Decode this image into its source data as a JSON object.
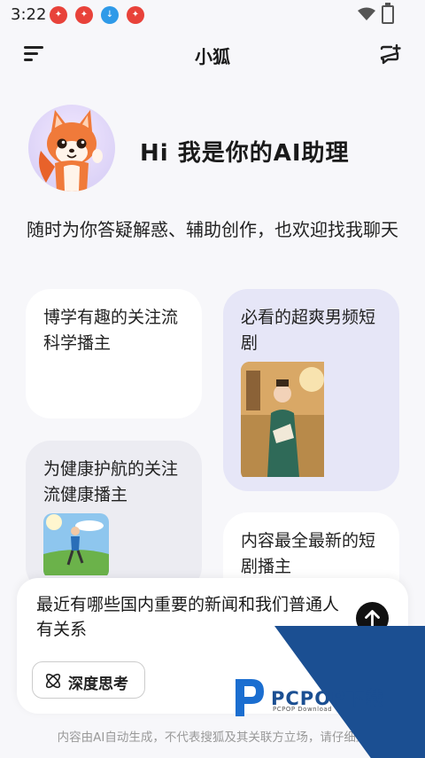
{
  "status_bar": {
    "time": "3:22"
  },
  "header": {
    "title": "小狐"
  },
  "hero": {
    "greeting": "Hi 我是你的AI助理"
  },
  "intro": "随时为你答疑解惑、辅助创作，也欢迎找我聊天",
  "cards": [
    {
      "text": "博学有趣的关注流科学播主"
    },
    {
      "text": "必看的超爽男频短剧"
    },
    {
      "text": "为健康护航的关注流健康播主"
    },
    {
      "text": "内容最全最新的短剧播主"
    }
  ],
  "input": {
    "prompt": "最近有哪些国内重要的新闻和我们普通人有关系",
    "deep_think_label": "深度思考"
  },
  "disclaimer": "内容由AI自动生成，不代表搜狐及其关联方立场，请仔细甄",
  "watermark": {
    "brand": "PCPOP下载",
    "sub": "PCPOP Download"
  },
  "colors": {
    "accent": "#1b4f92",
    "card_lavender": "#e6e6f7",
    "card_grey": "#ececf2"
  }
}
